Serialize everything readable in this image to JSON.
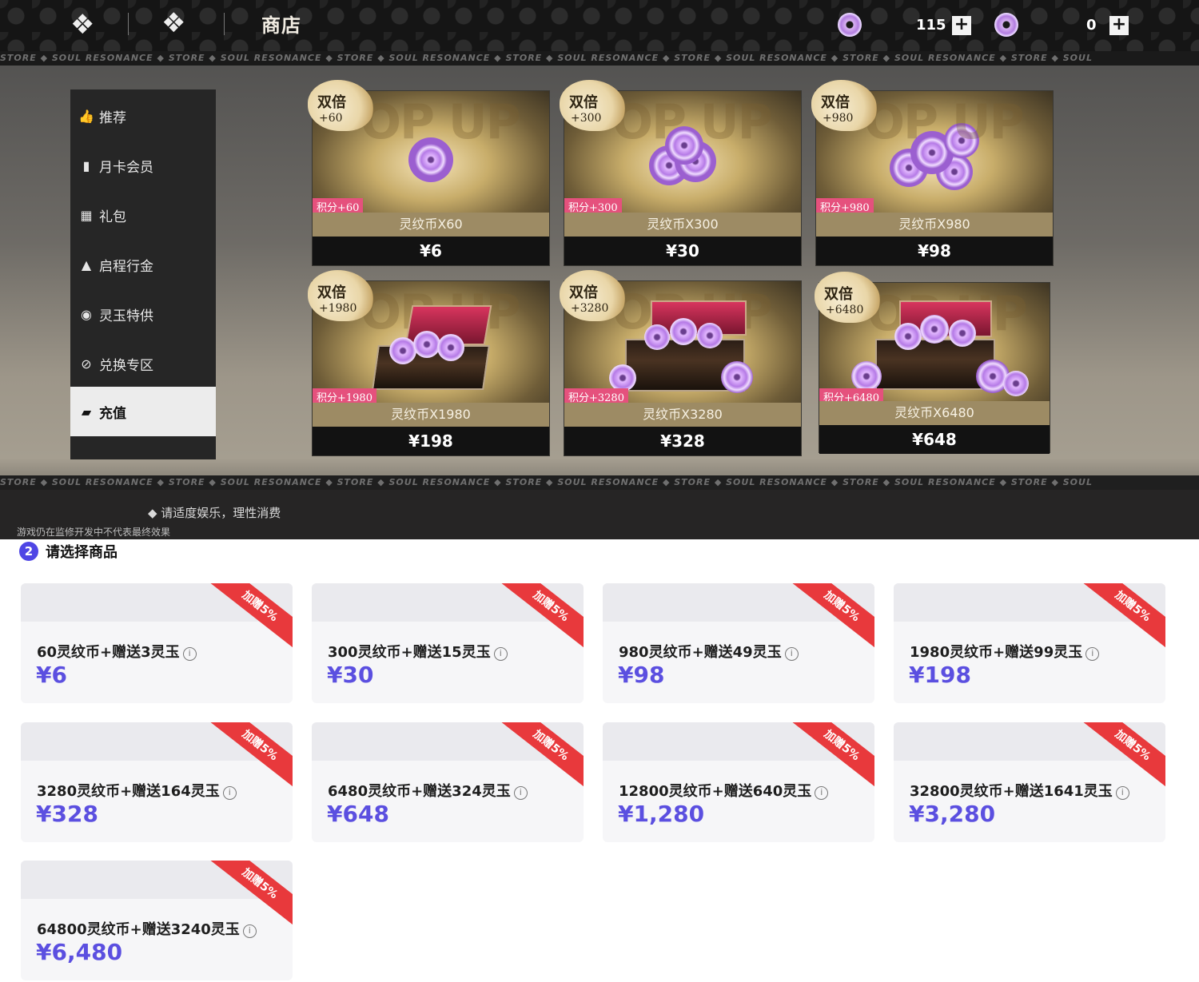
{
  "header": {
    "title": "商店",
    "currency1": {
      "icon": "soul-coin-icon",
      "value": "115"
    },
    "currency2": {
      "icon": "jade-icon",
      "value": "0"
    },
    "plus_label": "+"
  },
  "marquee_text": "STORE ◆ SOUL RESONANCE ◆ STORE ◆ SOUL RESONANCE ◆ STORE ◆ SOUL RESONANCE ◆ STORE ◆ SOUL RESONANCE ◆ STORE ◆ SOUL RESONANCE ◆ STORE ◆ SOUL RESONANCE ◆ STORE ◆ SOUL",
  "sidebar": {
    "items": [
      {
        "label": "推荐",
        "icon": "thumbs-up-icon"
      },
      {
        "label": "月卡会员",
        "icon": "card-icon"
      },
      {
        "label": "礼包",
        "icon": "gift-icon"
      },
      {
        "label": "启程行金",
        "icon": "gold-bars-icon"
      },
      {
        "label": "灵玉特供",
        "icon": "jade-special-icon"
      },
      {
        "label": "兑换专区",
        "icon": "exchange-icon"
      },
      {
        "label": "充值",
        "icon": "wallet-icon",
        "active": true
      }
    ]
  },
  "cards": [
    {
      "badge_title": "双倍",
      "badge_bonus": "+60",
      "points": "积分+60",
      "name": "灵纹币X60",
      "price": "¥6"
    },
    {
      "badge_title": "双倍",
      "badge_bonus": "+300",
      "points": "积分+300",
      "name": "灵纹币X300",
      "price": "¥30"
    },
    {
      "badge_title": "双倍",
      "badge_bonus": "+980",
      "points": "积分+980",
      "name": "灵纹币X980",
      "price": "¥98"
    },
    {
      "badge_title": "双倍",
      "badge_bonus": "+1980",
      "points": "积分+1980",
      "name": "灵纹币X1980",
      "price": "¥198"
    },
    {
      "badge_title": "双倍",
      "badge_bonus": "+3280",
      "points": "积分+3280",
      "name": "灵纹币X3280",
      "price": "¥328"
    },
    {
      "badge_title": "双倍",
      "badge_bonus": "+6480",
      "points": "积分+6480",
      "name": "灵纹币X6480",
      "price": "¥648"
    }
  ],
  "card_bg_text": "OP UP",
  "footer": {
    "note": "◆ 请适度娱乐，理性消费",
    "disclaimer": "游戏仍在监修开发中不代表最终效果"
  },
  "section": {
    "step_number": "2",
    "title": "请选择商品"
  },
  "ribbon_label": "加赠5%",
  "info_glyph": "i",
  "products": [
    {
      "desc": "60灵纹币+赠送3灵玉",
      "price": "¥6"
    },
    {
      "desc": "300灵纹币+赠送15灵玉",
      "price": "¥30"
    },
    {
      "desc": "980灵纹币+赠送49灵玉",
      "price": "¥98"
    },
    {
      "desc": "1980灵纹币+赠送99灵玉",
      "price": "¥198"
    },
    {
      "desc": "3280灵纹币+赠送164灵玉",
      "price": "¥328"
    },
    {
      "desc": "6480灵纹币+赠送324灵玉",
      "price": "¥648"
    },
    {
      "desc": "12800灵纹币+赠送640灵玉",
      "price": "¥1,280"
    },
    {
      "desc": "32800灵纹币+赠送1641灵玉",
      "price": "¥3,280"
    },
    {
      "desc": "64800灵纹币+赠送3240灵玉",
      "price": "¥6,480"
    }
  ],
  "colors": {
    "accent": "#5b4fe0",
    "ribbon": "#e8393c",
    "points_tag": "#e5517d"
  }
}
